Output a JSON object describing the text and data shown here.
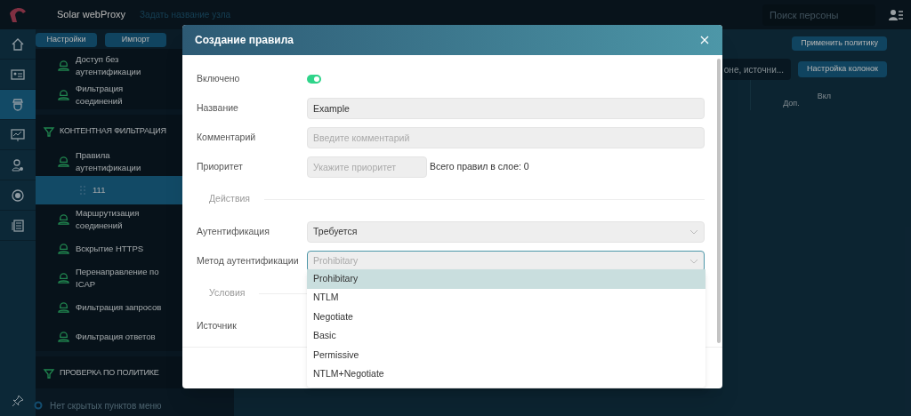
{
  "header": {
    "app_name": "Solar webProxy",
    "node_name_placeholder": "Задать название узла",
    "person_search": {
      "placeholder": "Поиск персоны"
    }
  },
  "rail": [
    {
      "selected": false
    },
    {
      "selected": false
    },
    {
      "selected": true
    },
    {
      "selected": false
    },
    {
      "selected": false
    },
    {
      "selected": false
    },
    {
      "selected": false
    }
  ],
  "toolbar_buttons": [
    "Настройки",
    "Импорт"
  ],
  "sidebar": {
    "groups": [
      {
        "items": [
          {
            "label": "Доступ без аутентификации",
            "selected": false
          },
          {
            "label": "Фильтрация соединений",
            "selected": false
          }
        ]
      },
      {
        "title": "КОНТЕНТНАЯ ФИЛЬТРАЦИЯ",
        "items": [
          {
            "label": "Правила аутентификации",
            "selected": false,
            "children": [
              {
                "label": "111",
                "selected": true
              }
            ]
          },
          {
            "label": "Маршрутизация соединений",
            "selected": false
          },
          {
            "label": "Вскрытие HTTPS",
            "selected": false
          },
          {
            "label": "Перенаправление по ICAP",
            "selected": false
          },
          {
            "label": "Фильтрация запросов",
            "selected": false
          },
          {
            "label": "Фильтрация ответов",
            "selected": false
          }
        ]
      },
      {
        "title": "ПРОВЕРКА ПО ПОЛИТИКЕ"
      }
    ],
    "footer": "Нет скрытых пунктов меню"
  },
  "content": {
    "apply_button": "Применить политику",
    "columns_button": "Настройка колонок",
    "search": {
      "placeholder": "оне, источни..."
    },
    "columns": [
      "Доп.",
      "Вкл"
    ]
  },
  "dialog": {
    "title": "Создание правила",
    "fields": [
      {
        "kind": "toggle",
        "label": "Включено",
        "on": true
      },
      {
        "kind": "text",
        "label": "Название",
        "value": "Example"
      },
      {
        "kind": "text",
        "label": "Комментарий",
        "placeholder": "Введите комментарий"
      },
      {
        "kind": "priority",
        "label": "Приоритет",
        "placeholder": "Укажите приоритет",
        "note": "Всего правил в слое: 0"
      },
      {
        "kind": "section",
        "label": "Действия"
      },
      {
        "kind": "select",
        "label": "Аутентификация",
        "value": "Требуется",
        "focused": false
      },
      {
        "kind": "select",
        "label": "Метод аутентификации",
        "placeholder": "Prohibitary",
        "focused": true
      },
      {
        "kind": "section",
        "label": "Условия"
      },
      {
        "kind": "empty",
        "label": "Источник"
      }
    ],
    "dropdown": [
      {
        "label": "Prohibitary",
        "selected": true
      },
      {
        "label": "NTLM",
        "selected": false
      },
      {
        "label": "Negotiate",
        "selected": false
      },
      {
        "label": "Basic",
        "selected": false
      },
      {
        "label": "Permissive",
        "selected": false
      },
      {
        "label": "NTLM+Negotiate",
        "selected": false
      }
    ]
  }
}
